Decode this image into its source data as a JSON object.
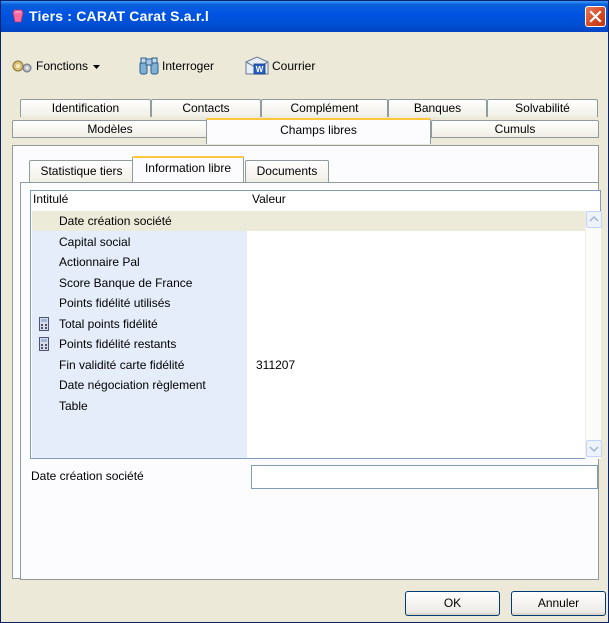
{
  "window": {
    "title": "Tiers : CARAT Carat S.a.r.l"
  },
  "toolbar": {
    "fonctions_label": "Fonctions",
    "interroger_label": "Interroger",
    "courrier_label": "Courrier"
  },
  "tabs_row1": [
    {
      "label": "Identification"
    },
    {
      "label": "Contacts"
    },
    {
      "label": "Complément"
    },
    {
      "label": "Banques"
    },
    {
      "label": "Solvabilité"
    }
  ],
  "tabs_row2": [
    {
      "label": "Modèles"
    },
    {
      "label": "Champs libres"
    },
    {
      "label": "Cumuls"
    }
  ],
  "inner_tabs": [
    {
      "label": "Statistique tiers"
    },
    {
      "label": "Information libre"
    },
    {
      "label": "Documents"
    }
  ],
  "grid": {
    "col_intitule": "Intitulé",
    "col_valeur": "Valeur",
    "rows": [
      {
        "label": "Date création société",
        "value": ""
      },
      {
        "label": "Capital social",
        "value": ""
      },
      {
        "label": "Actionnaire Pal",
        "value": ""
      },
      {
        "label": "Score Banque de France",
        "value": ""
      },
      {
        "label": "Points fidélité utilisés",
        "value": ""
      },
      {
        "label": "Total points fidélité",
        "value": ""
      },
      {
        "label": "Points fidélité restants",
        "value": ""
      },
      {
        "label": "Fin validité carte fidélité",
        "value": "311207"
      },
      {
        "label": "Date négociation règlement",
        "value": ""
      },
      {
        "label": "Table",
        "value": ""
      }
    ]
  },
  "field": {
    "label": "Date création société",
    "value": ""
  },
  "buttons": {
    "ok": "OK",
    "annuler": "Annuler"
  },
  "colors": {
    "titlebar": "#0054e3",
    "selected_tab_accent": "#ffc83c",
    "grid_left_bg": "#e4edf9"
  }
}
